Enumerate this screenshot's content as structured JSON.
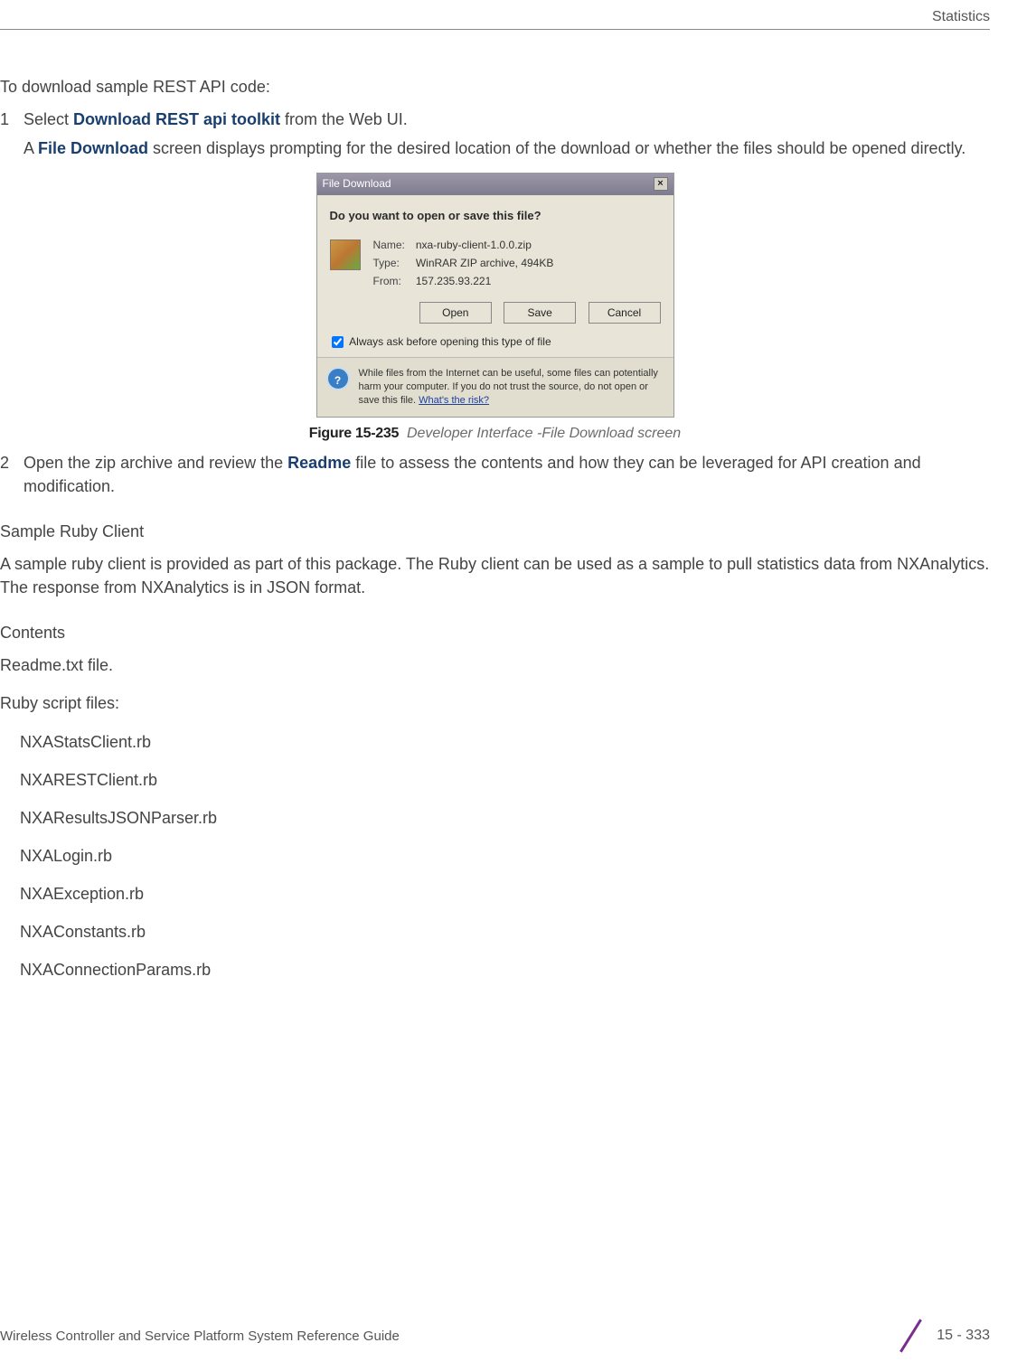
{
  "header": {
    "section": "Statistics"
  },
  "intro": "To download sample REST API code:",
  "step1": {
    "num": "1",
    "pre": "Select ",
    "bold": "Download REST api toolkit",
    "post": " from the Web UI."
  },
  "step1b": {
    "pre": "A ",
    "bold": "File Download",
    "post": " screen displays prompting for the desired location of the download or whether the files should be opened directly."
  },
  "dialog": {
    "title": "File Download",
    "question": "Do you want to open or save this file?",
    "name_label": "Name:",
    "name_value": "nxa-ruby-client-1.0.0.zip",
    "type_label": "Type:",
    "type_value": "WinRAR ZIP archive, 494KB",
    "from_label": "From:",
    "from_value": "157.235.93.221",
    "open": "Open",
    "save": "Save",
    "cancel": "Cancel",
    "always": "Always ask before opening this type of file",
    "warn": "While files from the Internet can be useful, some files can potentially harm your computer. If you do not trust the source, do not open or save this file. ",
    "warn_link": "What's the risk?"
  },
  "figure": {
    "label": "Figure 15-235",
    "caption": "Developer Interface -File Download screen"
  },
  "step2": {
    "num": "2",
    "pre": "Open the zip archive and review the ",
    "bold": "Readme",
    "post": " file to assess the contents and how they can be leveraged for API creation and modification."
  },
  "ruby_head": "Sample Ruby Client",
  "ruby_para": "A sample ruby client is provided as part of this package. The Ruby client can be used as a sample to pull statistics data from NXAnalytics. The response from NXAnalytics is in JSON format.",
  "contents_head": "Contents",
  "readme_line": "Readme.txt file.",
  "scripts_line": "Ruby script files:",
  "files": [
    "NXAStatsClient.rb",
    "NXARESTClient.rb",
    "NXAResultsJSONParser.rb",
    "NXALogin.rb",
    "NXAException.rb",
    "NXAConstants.rb",
    "NXAConnectionParams.rb"
  ],
  "footer": {
    "title": "Wireless Controller and Service Platform System Reference Guide",
    "page": "15 - 333"
  }
}
